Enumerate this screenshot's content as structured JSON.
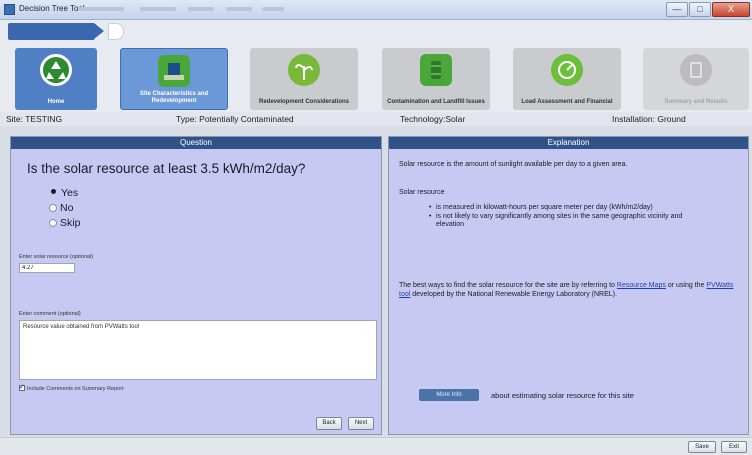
{
  "window": {
    "title": "Decision Tree Tool",
    "controls": [
      "—",
      "□",
      "X"
    ]
  },
  "nav": {
    "tiles": [
      {
        "label": "Home",
        "icon": "recycle-icon",
        "state": "active",
        "color": "#2e8a2e"
      },
      {
        "label": "Site Characteristics and Redevelopment",
        "icon": "building-icon",
        "state": "current",
        "color": "#4aa83a"
      },
      {
        "label": "Redevelopment Considerations",
        "icon": "plant-icon",
        "state": "inactive",
        "color": "#7ab83a"
      },
      {
        "label": "Contamination and Landfill Issues",
        "icon": "barrel-icon",
        "state": "inactive",
        "color": "#4aa83a"
      },
      {
        "label": "Load Assessment and Financial",
        "icon": "meter-icon",
        "state": "inactive",
        "color": "#6cbf3a"
      },
      {
        "label": "Summary and Results",
        "icon": "summary-icon",
        "state": "disabled",
        "color": "#b5b5b8"
      }
    ]
  },
  "info": {
    "site": "Site: TESTING",
    "type": "Type: Potentially Contaminated",
    "technology": "Technology:Solar",
    "installation": "Installation: Ground"
  },
  "question_panel": {
    "header": "Question",
    "question": "Is the solar resource at least 3.5 kWh/m2/day?",
    "options": [
      {
        "label": "Yes",
        "selected": true
      },
      {
        "label": "No",
        "selected": false
      },
      {
        "label": "Skip",
        "selected": false
      }
    ],
    "solar_label": "Enter solar resource (optional)",
    "solar_value": "4.27",
    "comment_label": "Enter comment (optional)",
    "comment_value": "Resource value obtained from PVWatts tool",
    "include_label": "Include Comments on Summary Report",
    "back_label": "Back",
    "next_label": "Next"
  },
  "explanation_panel": {
    "header": "Explanation",
    "intro": "Solar resource is the amount of sunlight available per day to a given area.",
    "subheading": "Solar resource",
    "bullets": [
      "is measured in kilowatt-hours per square meter per day (kWh/m2/day)",
      "is not likely to vary significantly among sites in the same geographic vicinity and elevation"
    ],
    "para_before": "The best ways to find the solar resource for the site are by referring to",
    "link_maps": "Resource Maps",
    "para_mid": "or using the",
    "link_pvwatts": "PVWatts tool",
    "para_after": "developed by the National Renewable Energy Laboratory (NREL).",
    "more_info_label": "More Info",
    "more_info_text": "about estimating solar resource for this site"
  },
  "footer": {
    "save_label": "Save",
    "exit_label": "Exit"
  }
}
